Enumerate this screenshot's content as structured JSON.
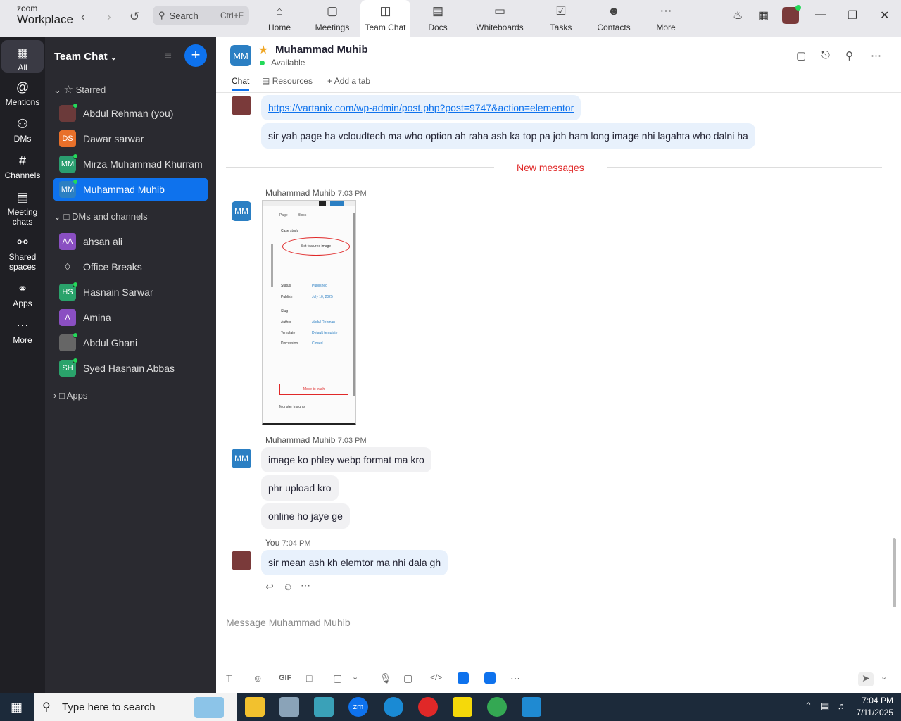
{
  "app": {
    "brand_small": "zoom",
    "brand_big": "Workplace"
  },
  "search": {
    "label": "Search",
    "shortcut": "Ctrl+F"
  },
  "nav_tabs": [
    {
      "label": "Home",
      "icon": "home-icon"
    },
    {
      "label": "Meetings",
      "icon": "video-icon"
    },
    {
      "label": "Team Chat",
      "icon": "chat-icon"
    },
    {
      "label": "Docs",
      "icon": "doc-icon"
    },
    {
      "label": "Whiteboards",
      "icon": "whiteboard-icon"
    },
    {
      "label": "Tasks",
      "icon": "tasks-icon"
    },
    {
      "label": "Contacts",
      "icon": "contacts-icon"
    },
    {
      "label": "More",
      "icon": "more-icon"
    }
  ],
  "rail": [
    {
      "label": "All"
    },
    {
      "label": "Mentions"
    },
    {
      "label": "DMs"
    },
    {
      "label": "Channels"
    },
    {
      "label": "Meeting chats"
    },
    {
      "label": "Shared spaces"
    },
    {
      "label": "Apps"
    },
    {
      "label": "More"
    }
  ],
  "sidebar": {
    "title": "Team Chat",
    "starred_label": "Starred",
    "starred": [
      {
        "name": "Abdul Rehman (you)",
        "initials": "",
        "color": "#6b3a3a"
      },
      {
        "name": "Dawar sarwar",
        "initials": "DS",
        "color": "#e8702a"
      },
      {
        "name": "Mirza Muhammad Khurram",
        "initials": "MM",
        "color": "#2a9d6f"
      },
      {
        "name": "Muhammad Muhib",
        "initials": "MM",
        "color": "#2b7fc3"
      }
    ],
    "dms_label": "DMs and channels",
    "dms": [
      {
        "name": "ahsan ali",
        "initials": "AA",
        "color": "#8a4fc2"
      },
      {
        "name": "Office Breaks",
        "initials": "",
        "color": ""
      },
      {
        "name": "Hasnain Sarwar",
        "initials": "HS",
        "color": "#2aa36b"
      },
      {
        "name": "Amina",
        "initials": "A",
        "color": "#8a4fc2"
      },
      {
        "name": "Abdul Ghani",
        "initials": "",
        "color": "#555"
      },
      {
        "name": "Syed Hasnain Abbas",
        "initials": "SH",
        "color": "#2aa36b"
      }
    ],
    "apps_label": "Apps"
  },
  "chat": {
    "initials": "MM",
    "name": "Muhammad Muhib",
    "status": "Available",
    "tabs": [
      "Chat",
      "Resources",
      "Add a tab"
    ],
    "new_messages_label": "New messages",
    "messages": {
      "link": "https://vartanix.com/wp-admin/post.php?post=9747&action=elementor",
      "msg1": "sir yah page ha vcloudtech ma who option ah raha ash ka top pa joh ham long image nhi lagahta who dalni ha",
      "sender_muhib": "Muhammad Muhib",
      "time_1": "7:03 PM",
      "time_2": "7:03 PM",
      "msg2": "image ko phley webp format ma kro",
      "msg3": "phr upload kro",
      "msg4": "online ho jaye ge",
      "sender_you": "You",
      "time_3": "7:04 PM",
      "msg5": "sir mean ash kh elemtor ma nhi dala gh"
    },
    "compose_placeholder": "Message Muhammad Muhib",
    "gif_label": "GIF"
  },
  "screenshot_thumb": {
    "tab_page": "Page",
    "tab_block": "Block",
    "case_study": "Case study",
    "set_featured": "Set featured image",
    "status": "Status",
    "status_value": "Published",
    "publish": "Publish",
    "publish_value": "July 10, 2025",
    "slug": "Slug",
    "author": "Author",
    "author_value": "Abdul Rehman",
    "template": "Template",
    "template_value": "Default template",
    "discussion": "Discussion",
    "discussion_value": "Closed",
    "move_to_trash": "Move to trash",
    "more": "Monster Insights"
  },
  "taskbar": {
    "search": "Type here to search",
    "time": "7:04 PM",
    "date": "7/11/2025"
  }
}
